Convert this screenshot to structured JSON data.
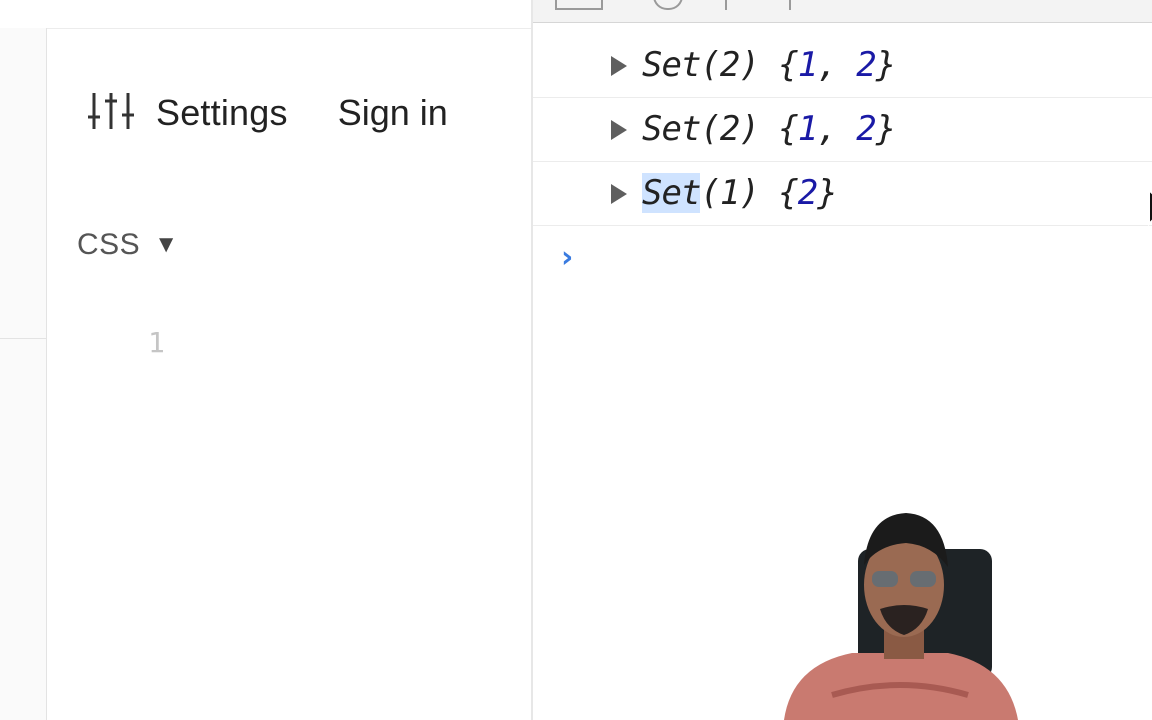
{
  "editor": {
    "settings_label": "Settings",
    "signin_label": "Sign in",
    "language_label": "CSS",
    "language_caret": "▼",
    "line_numbers": [
      "1"
    ]
  },
  "console": {
    "entries": [
      {
        "prefix": "Set(2) {",
        "values": [
          "1",
          "2"
        ],
        "suffix": "}"
      },
      {
        "prefix": "Set(2) {",
        "values": [
          "1",
          "2"
        ],
        "suffix": "}"
      },
      {
        "prefix": "Set(1) {",
        "values": [
          "2"
        ],
        "suffix": "}"
      }
    ],
    "prompt_symbol": "›"
  },
  "icons": {
    "settings": "sliders-icon",
    "expand": "triangle-right-icon",
    "prompt": "chevron-right-icon",
    "cursor": "mouse-pointer-icon"
  },
  "colors": {
    "number": "#1a1aa6",
    "prompt": "#3a7be0",
    "selection": "#cfe3ff"
  }
}
